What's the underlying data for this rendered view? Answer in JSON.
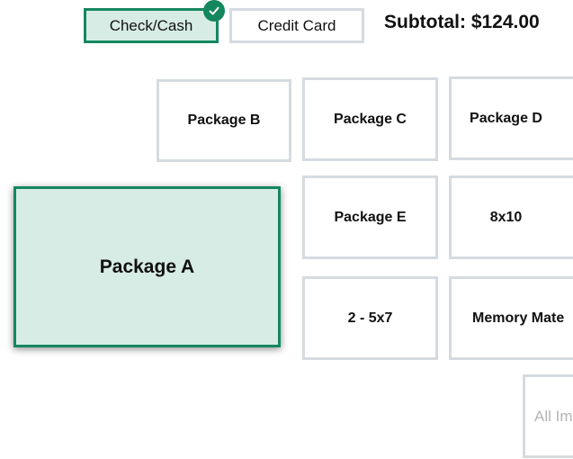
{
  "payment": {
    "options": [
      {
        "label": "Check/Cash",
        "selected": true
      },
      {
        "label": "Credit Card",
        "selected": false
      }
    ],
    "selected_icon": "check-icon"
  },
  "subtotal": {
    "label": "Subtotal: $124.00"
  },
  "packages": [
    {
      "label": "Package A",
      "selected": true
    },
    {
      "label": "Package B"
    },
    {
      "label": "Package C"
    },
    {
      "label": "Package D"
    },
    {
      "label": "Package E"
    },
    {
      "label": "8x10"
    },
    {
      "label": "2 - 5x7"
    },
    {
      "label": "Memory Mate"
    },
    {
      "label": "All Images",
      "disabled": true
    }
  ],
  "colors": {
    "accent": "#15875f",
    "selected_bg": "#d7ece5",
    "border": "#d5dbe0"
  }
}
